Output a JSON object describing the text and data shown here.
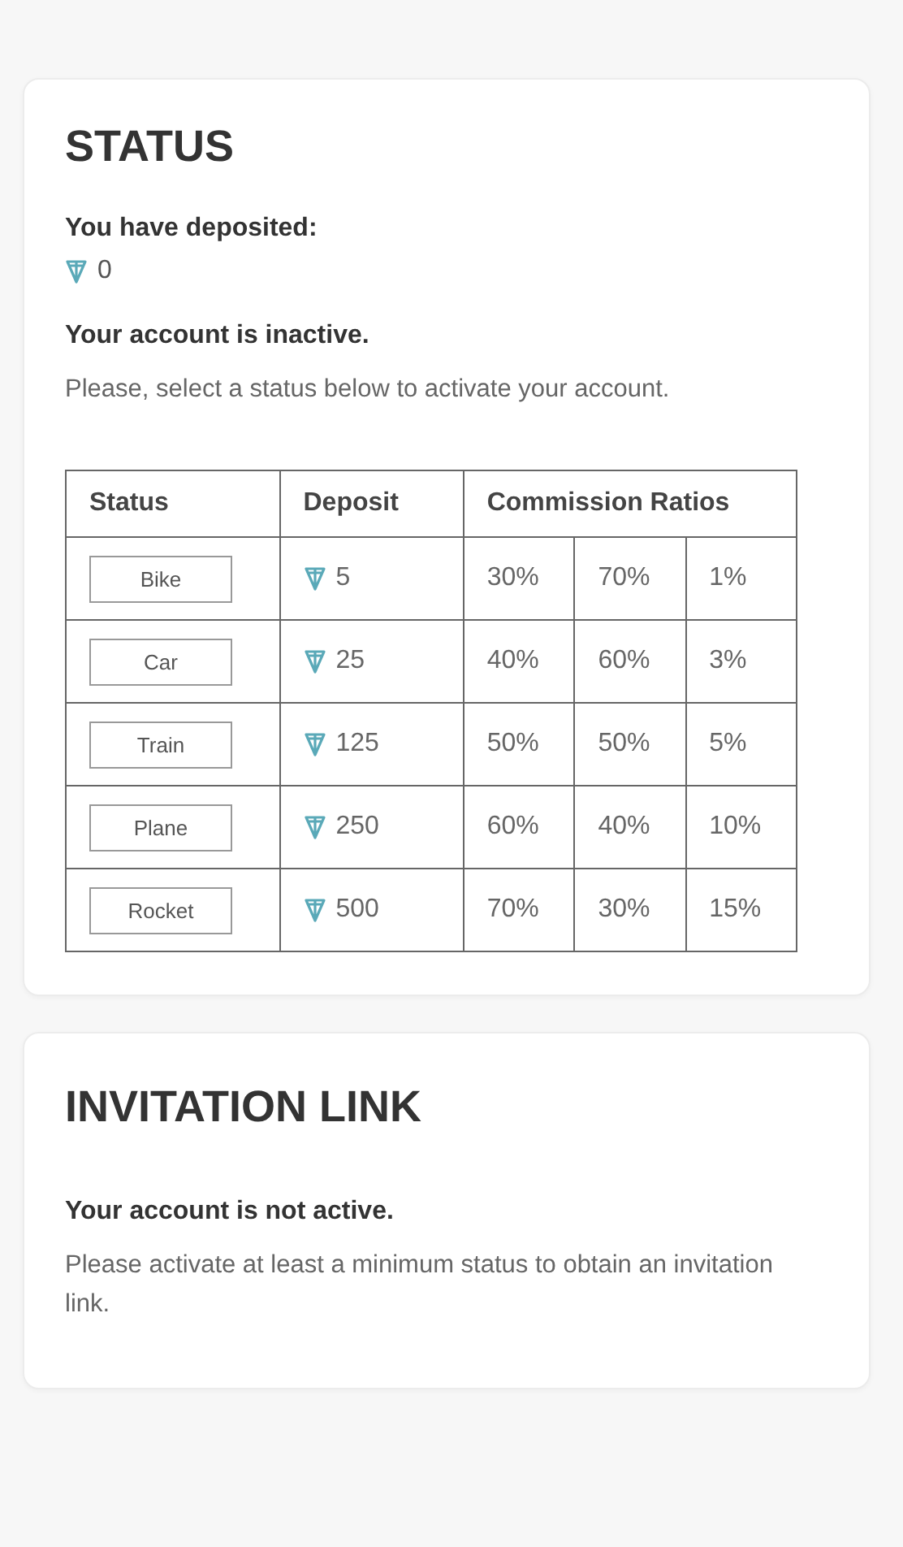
{
  "status_card": {
    "title": "STATUS",
    "deposited_label": "You have deposited:",
    "deposited_amount": "0",
    "account_state": "Your account is inactive.",
    "instruction": "Please, select a status below to activate your account.",
    "table": {
      "columns": [
        "Status",
        "Deposit",
        "Commission Ratios"
      ],
      "rows": [
        {
          "status": "Bike",
          "deposit": "5",
          "ratios": [
            "30%",
            "70%",
            "1%"
          ]
        },
        {
          "status": "Car",
          "deposit": "25",
          "ratios": [
            "40%",
            "60%",
            "3%"
          ]
        },
        {
          "status": "Train",
          "deposit": "125",
          "ratios": [
            "50%",
            "50%",
            "5%"
          ]
        },
        {
          "status": "Plane",
          "deposit": "250",
          "ratios": [
            "60%",
            "40%",
            "10%"
          ]
        },
        {
          "status": "Rocket",
          "deposit": "500",
          "ratios": [
            "70%",
            "30%",
            "15%"
          ]
        }
      ]
    }
  },
  "invitation_card": {
    "title": "INVITATION LINK",
    "account_state": "Your account is not active.",
    "instruction": "Please activate at least a minimum status to obtain an invitation link."
  }
}
